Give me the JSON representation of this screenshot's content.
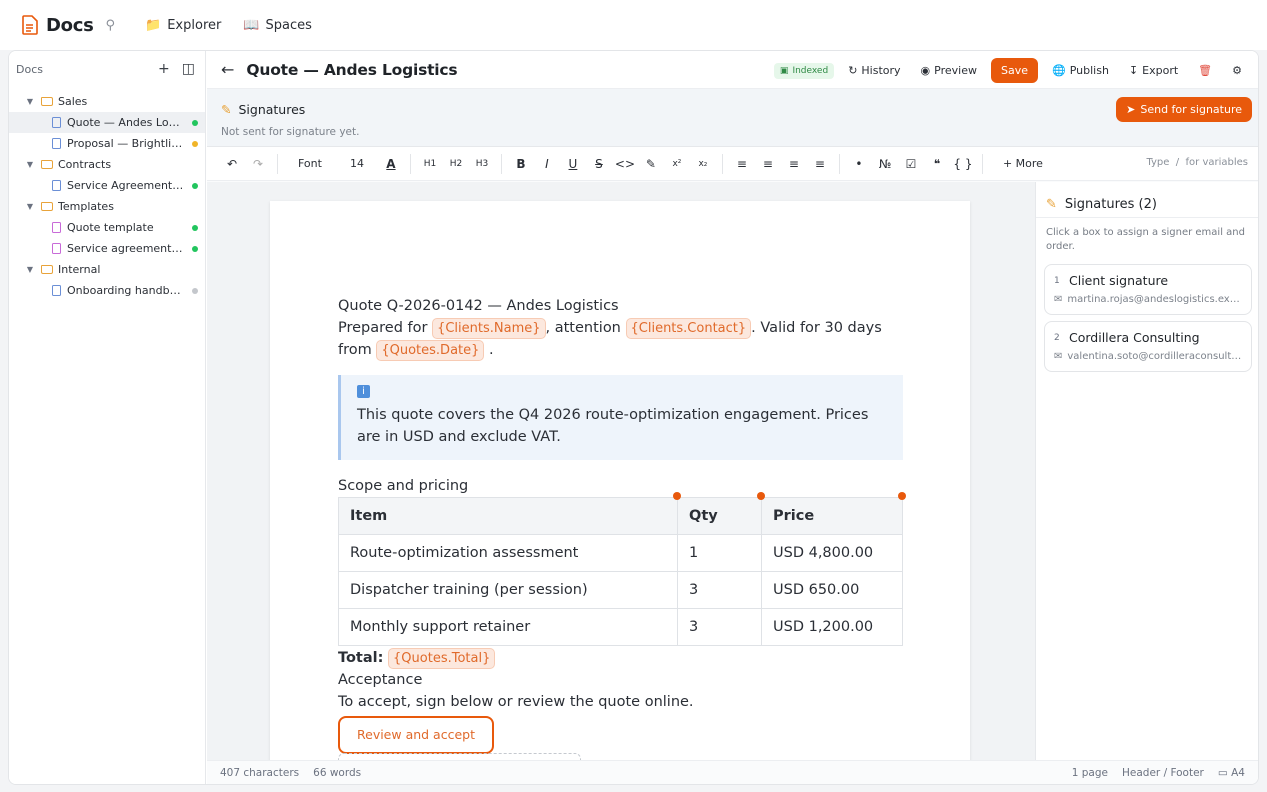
{
  "app": {
    "title": "Docs",
    "nav": [
      "Explorer",
      "Spaces"
    ]
  },
  "sidebar": {
    "header": "Docs",
    "items": [
      {
        "type": "folder",
        "label": "Sales"
      },
      {
        "type": "doc",
        "label": "Quote — Andes Logistics",
        "status": "green",
        "selected": true
      },
      {
        "type": "doc",
        "label": "Proposal — Brightline Foods",
        "status": "amber"
      },
      {
        "type": "folder",
        "label": "Contracts"
      },
      {
        "type": "doc",
        "label": "Service Agreement — Andes",
        "status": "green"
      },
      {
        "type": "folder",
        "label": "Templates"
      },
      {
        "type": "template",
        "label": "Quote template",
        "status": "green"
      },
      {
        "type": "template",
        "label": "Service agreement template",
        "status": "green"
      },
      {
        "type": "folder",
        "label": "Internal"
      },
      {
        "type": "doc",
        "label": "Onboarding handbook",
        "status": "gray"
      }
    ]
  },
  "header": {
    "title": "Quote — Andes Logistics",
    "badge": "Indexed",
    "history": "History",
    "preview": "Preview",
    "save": "Save",
    "publish": "Publish",
    "export": "Export"
  },
  "signatures_bar": {
    "title": "Signatures",
    "subtitle": "Not sent for signature yet.",
    "send": "Send for signature"
  },
  "toolbar": {
    "font": "Font",
    "size": "14",
    "more": "More",
    "hint_type": "Type",
    "hint_slash": "/",
    "hint_vars": "for variables"
  },
  "document": {
    "heading": "Quote Q-2026-0142 — Andes Logistics",
    "prepared_for": "Prepared for",
    "var_client": "{Clients.Name}",
    "attention": ", attention",
    "var_contact": "{Clients.Contact}",
    "valid": ". Valid for 30 days from",
    "var_date": "{Quotes.Date}",
    "period": ".",
    "callout": "This quote covers the Q4 2026 route-optimization engagement. Prices are in USD and exclude VAT.",
    "scope": "Scope and pricing",
    "table": {
      "headers": [
        "Item",
        "Qty",
        "Price"
      ],
      "rows": [
        [
          "Route-optimization assessment",
          "1",
          "USD 4,800.00"
        ],
        [
          "Dispatcher training (per session)",
          "3",
          "USD 650.00"
        ],
        [
          "Monthly support retainer",
          "3",
          "USD 1,200.00"
        ]
      ]
    },
    "total_label": "Total:",
    "var_total": "{Quotes.Total}",
    "acceptance": "Acceptance",
    "accept_text": "To accept, sign below or review the quote online.",
    "review_button": "Review and accept"
  },
  "right_panel": {
    "title": "Signatures (2)",
    "subtitle": "Click a box to assign a signer email and order.",
    "signers": [
      {
        "num": "1",
        "name": "Client signature",
        "email": "martina.rojas@andeslogistics.example"
      },
      {
        "num": "2",
        "name": "Cordillera Consulting",
        "email": "valentina.soto@cordilleraconsulting.example"
      }
    ]
  },
  "status": {
    "chars": "407 characters",
    "words": "66 words",
    "pages": "1 page",
    "header_footer": "Header / Footer",
    "paper": "A4"
  }
}
